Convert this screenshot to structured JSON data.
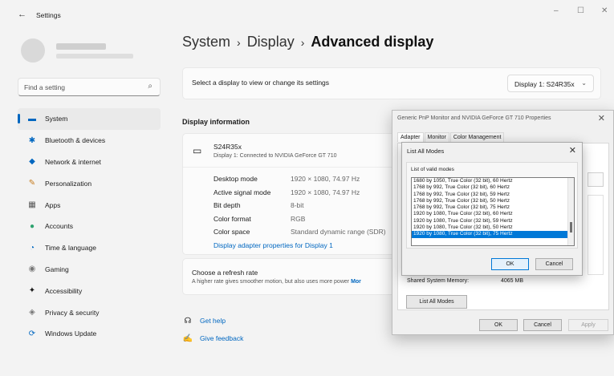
{
  "window": {
    "back_glyph": "←",
    "title": "Settings",
    "min_glyph": "–",
    "max_glyph": "☐",
    "close_glyph": "✕"
  },
  "search": {
    "placeholder": "Find a setting",
    "icon": "⌕"
  },
  "sidebar": {
    "items": [
      {
        "label": "System",
        "icon": "▬",
        "icon_name": "display-icon",
        "color": "#0067c0",
        "active": true
      },
      {
        "label": "Bluetooth & devices",
        "icon": "✱",
        "icon_name": "bluetooth-icon",
        "color": "#0067c0"
      },
      {
        "label": "Network & internet",
        "icon": "◆",
        "icon_name": "wifi-icon",
        "color": "#0067c0"
      },
      {
        "label": "Personalization",
        "icon": "✎",
        "icon_name": "brush-icon",
        "color": "#c67c1f"
      },
      {
        "label": "Apps",
        "icon": "▦",
        "icon_name": "apps-icon",
        "color": "#555555"
      },
      {
        "label": "Accounts",
        "icon": "●",
        "icon_name": "person-icon",
        "color": "#2ea36f"
      },
      {
        "label": "Time & language",
        "icon": "◔",
        "icon_name": "globe-clock-icon",
        "color": "#0067c0"
      },
      {
        "label": "Gaming",
        "icon": "◉",
        "icon_name": "controller-icon",
        "color": "#777777"
      },
      {
        "label": "Accessibility",
        "icon": "✦",
        "icon_name": "accessibility-icon",
        "color": "#1b1b1b"
      },
      {
        "label": "Privacy & security",
        "icon": "◈",
        "icon_name": "shield-icon",
        "color": "#777777"
      },
      {
        "label": "Windows Update",
        "icon": "⟳",
        "icon_name": "update-icon",
        "color": "#0067c0"
      }
    ]
  },
  "breadcrumb": {
    "part1": "System",
    "part2": "Display",
    "current": "Advanced display",
    "sep": "›"
  },
  "select_display": {
    "text": "Select a display to view or change its settings",
    "value": "Display 1: S24R35x",
    "chevron": "⌄"
  },
  "display_info": {
    "heading": "Display information",
    "monitor_name": "S24R35x",
    "monitor_sub": "Display 1: Connected to NVIDIA GeForce GT 710",
    "rows": [
      {
        "key": "Desktop mode",
        "value": "1920 × 1080, 74.97 Hz"
      },
      {
        "key": "Active signal mode",
        "value": "1920 × 1080, 74.97 Hz"
      },
      {
        "key": "Bit depth",
        "value": "8-bit"
      },
      {
        "key": "Color format",
        "value": "RGB"
      },
      {
        "key": "Color space",
        "value": "Standard dynamic range (SDR)"
      }
    ],
    "adapter_link": "Display adapter properties for Display 1"
  },
  "refresh_rate": {
    "title": "Choose a refresh rate",
    "subtitle": "A higher rate gives smoother motion, but also uses more power",
    "more": "Mor"
  },
  "help": [
    {
      "label": "Get help",
      "icon": "☊",
      "icon_name": "help-icon"
    },
    {
      "label": "Give feedback",
      "icon": "✍",
      "icon_name": "feedback-icon"
    }
  ],
  "properties_dialog": {
    "title": "Generic PnP Monitor and NVIDIA GeForce GT 710 Properties",
    "tabs": [
      "Adapter",
      "Monitor",
      "Color Management"
    ],
    "shared_memory_label": "Shared System Memory:",
    "shared_memory_value": "4065 MB",
    "list_all_modes": "List All Modes",
    "ok": "OK",
    "cancel": "Cancel",
    "apply": "Apply"
  },
  "modes_dialog": {
    "title": "List All Modes",
    "list_label": "List of valid modes",
    "modes": [
      "1680 by 1050, True Color (32 bit), 60 Hertz",
      "1768 by 992, True Color (32 bit), 60 Hertz",
      "1768 by 992, True Color (32 bit), 59 Hertz",
      "1768 by 992, True Color (32 bit), 50 Hertz",
      "1768 by 992, True Color (32 bit), 75 Hertz",
      "1920 by 1080, True Color (32 bit), 60 Hertz",
      "1920 by 1080, True Color (32 bit), 59 Hertz",
      "1920 by 1080, True Color (32 bit), 50 Hertz",
      "1920 by 1080, True Color (32 bit), 75 Hertz"
    ],
    "selected_index": 8,
    "ok": "OK",
    "cancel": "Cancel"
  }
}
